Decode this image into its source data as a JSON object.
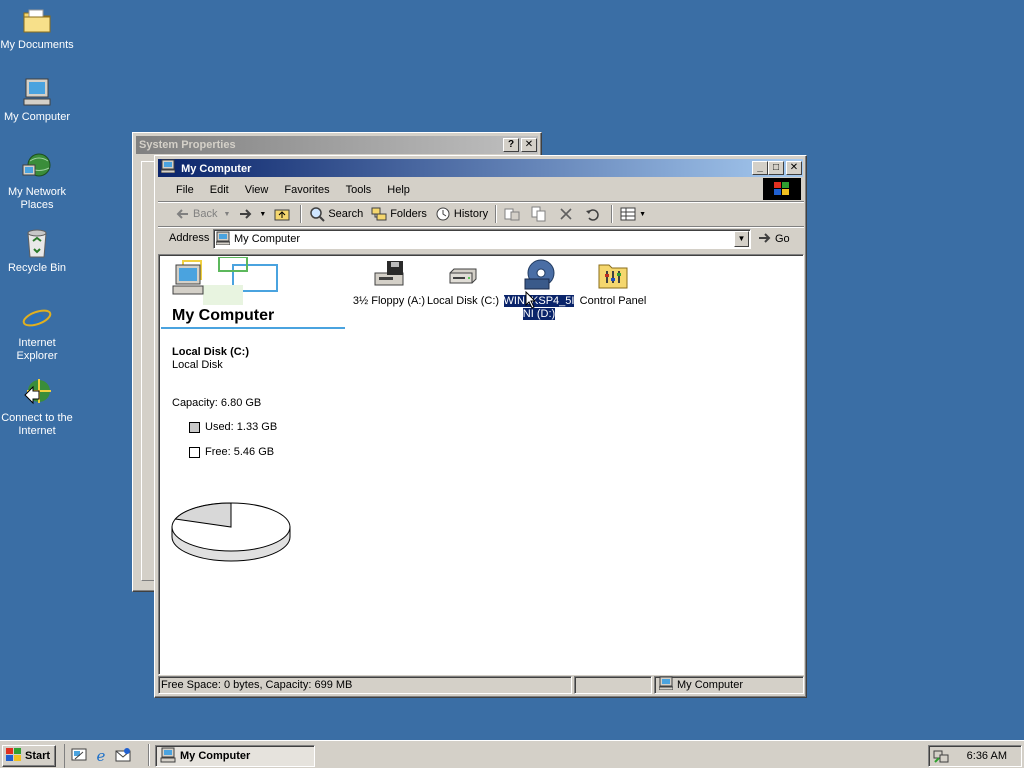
{
  "desktop": {
    "icons": [
      {
        "label": "My Documents"
      },
      {
        "label": "My Computer"
      },
      {
        "label": "My Network Places"
      },
      {
        "label": "Recycle Bin"
      },
      {
        "label": "Internet Explorer"
      },
      {
        "label": "Connect to the Internet"
      }
    ]
  },
  "system_properties": {
    "title": "System Properties",
    "help_btn": "?",
    "close_btn": "✕"
  },
  "my_computer": {
    "title": "My Computer",
    "controls": {
      "min": "_",
      "max": "□",
      "close": "✕"
    },
    "menu": [
      "File",
      "Edit",
      "View",
      "Favorites",
      "Tools",
      "Help"
    ],
    "toolbar": {
      "back": "Back",
      "search": "Search",
      "folders": "Folders",
      "history": "History"
    },
    "address": {
      "label": "Address",
      "value": "My Computer",
      "go": "Go"
    },
    "sidebar": {
      "heading": "My Computer",
      "drive_name": "Local Disk (C:)",
      "drive_type": "Local Disk",
      "capacity": "Capacity: 6.80 GB",
      "used": "Used: 1.33 GB",
      "free": "Free: 5.46 GB",
      "used_fraction": 0.196
    },
    "items": [
      {
        "label": "3½ Floppy (A:)",
        "icon": "floppy-drive-icon"
      },
      {
        "label": "Local Disk (C:)",
        "icon": "hard-disk-icon"
      },
      {
        "label": "WIN2KSP4_5I NI (D:)",
        "icon": "cd-drive-icon",
        "selected": true
      },
      {
        "label": "Control Panel",
        "icon": "control-panel-icon"
      }
    ],
    "status": {
      "left": "Free Space: 0 bytes, Capacity: 699 MB",
      "right": "My Computer"
    }
  },
  "taskbar": {
    "start": "Start",
    "task": "My Computer",
    "clock": "6:36 AM"
  },
  "colors": {
    "desktop": "#3a6ea5",
    "active_title": "#0a246a",
    "inactive_title": "#808080",
    "selection": "#0a246a",
    "face": "#d4d0c8"
  }
}
